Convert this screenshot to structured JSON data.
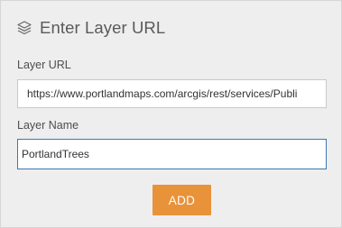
{
  "header": {
    "icon": "layers-icon",
    "title": "Enter Layer URL"
  },
  "form": {
    "url_label": "Layer URL",
    "url_value": "https://www.portlandmaps.com/arcgis/rest/services/Publi",
    "name_label": "Layer Name",
    "name_value": "PortlandTrees"
  },
  "actions": {
    "add_label": "ADD"
  },
  "colors": {
    "panel_background": "#eeeeee",
    "accent": "#e8923a",
    "focus_border": "#3c76b5"
  }
}
